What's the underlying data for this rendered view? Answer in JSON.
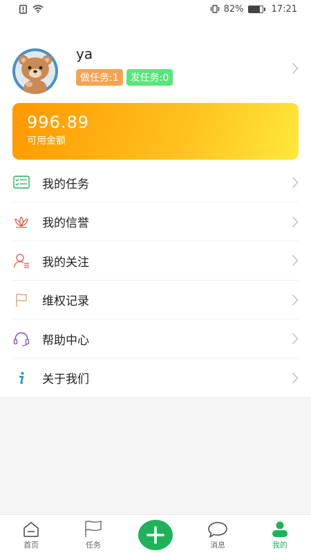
{
  "status_bar": {
    "battery_percent": "82%",
    "time": "17:21",
    "battery_level": 0.82
  },
  "profile": {
    "username": "ya",
    "badge_do_tasks": "做任务:1",
    "badge_post_tasks": "发任务:0"
  },
  "balance": {
    "amount": "996.89",
    "label": "可用金额"
  },
  "menu": {
    "items": [
      {
        "label": "我的任务",
        "icon": "task-list-icon"
      },
      {
        "label": "我的信誉",
        "icon": "lotus-icon"
      },
      {
        "label": "我的关注",
        "icon": "follow-user-icon"
      },
      {
        "label": "维权记录",
        "icon": "flag-icon"
      },
      {
        "label": "帮助中心",
        "icon": "headset-icon"
      },
      {
        "label": "关于我们",
        "icon": "info-icon"
      }
    ]
  },
  "tab_bar": {
    "tabs": [
      {
        "label": "首页",
        "icon": "home-icon"
      },
      {
        "label": "任务",
        "icon": "flag-icon"
      },
      {
        "label": "",
        "icon": "plus-icon"
      },
      {
        "label": "消息",
        "icon": "chat-bubble-icon"
      },
      {
        "label": "我的",
        "icon": "user-icon"
      }
    ],
    "active_index": 4
  },
  "colors": {
    "accent_green": "#1fb25a",
    "badge_orange": "#f5a352",
    "badge_green": "#57e67a",
    "card_gradient_start": "#ff9800",
    "card_gradient_end": "#ffe83a"
  }
}
